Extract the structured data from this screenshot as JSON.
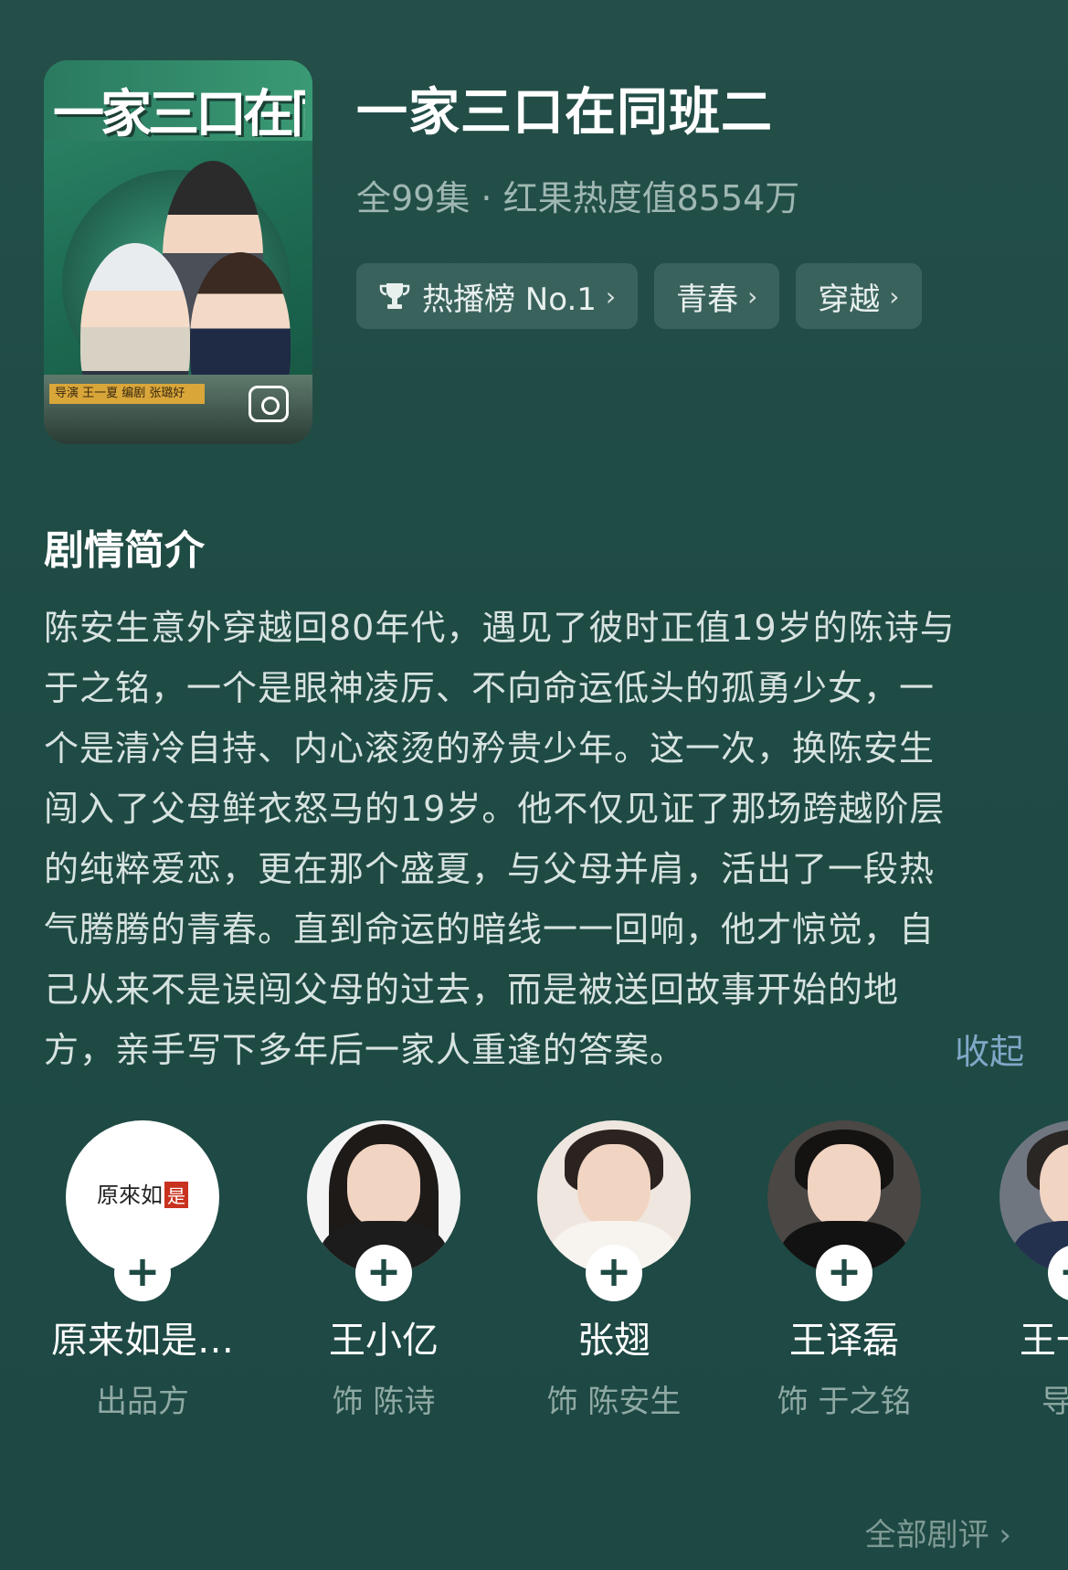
{
  "header": {
    "poster": {
      "title_art": "一家三口在同班二",
      "credit": "导演 王一夏 编剧 张璐好",
      "photo_icon": "gallery-photo-icon"
    },
    "title": "一家三口在同班二",
    "meta": "全99集 · 红果热度值8554万",
    "tags": [
      {
        "label": "热播榜 No.1",
        "icon": "trophy-icon"
      },
      {
        "label": "青春"
      },
      {
        "label": "穿越"
      }
    ]
  },
  "synopsis": {
    "heading": "剧情简介",
    "lines": [
      "陈安生意外穿越回80年代，遇见了彼时正值19岁的陈诗与",
      "于之铭，一个是眼神凌厉、不向命运低头的孤勇少女，一",
      "个是清冷自持、内心滚烫的矜贵少年。这一次，换陈安生",
      "闯入了父母鲜衣怒马的19岁。他不仅见证了那场跨越阶层",
      "的纯粹爱恋，更在那个盛夏，与父母并肩，活出了一段热",
      "气腾腾的青春。直到命运的暗线一一回响，他才惊觉，自",
      "己从来不是误闯父母的过去，而是被送回故事开始的地",
      "方，亲手写下多年后一家人重逢的答案。"
    ],
    "collapse_label": "收起"
  },
  "cast": [
    {
      "name": "原来如是…",
      "role": "出品方",
      "logo_text": "原來如",
      "logo_seal": "是"
    },
    {
      "name": "王小亿",
      "role": "饰 陈诗"
    },
    {
      "name": "张翅",
      "role": "饰 陈安生"
    },
    {
      "name": "王译磊",
      "role": "饰 于之铭"
    },
    {
      "name": "王一",
      "role": "导"
    }
  ],
  "footer": {
    "all_reviews_label": "全部剧评",
    "chevron": "›"
  },
  "colors": {
    "background": "#1f4a44",
    "tag_bg": "#3a625c",
    "link": "#7fa8c7"
  }
}
